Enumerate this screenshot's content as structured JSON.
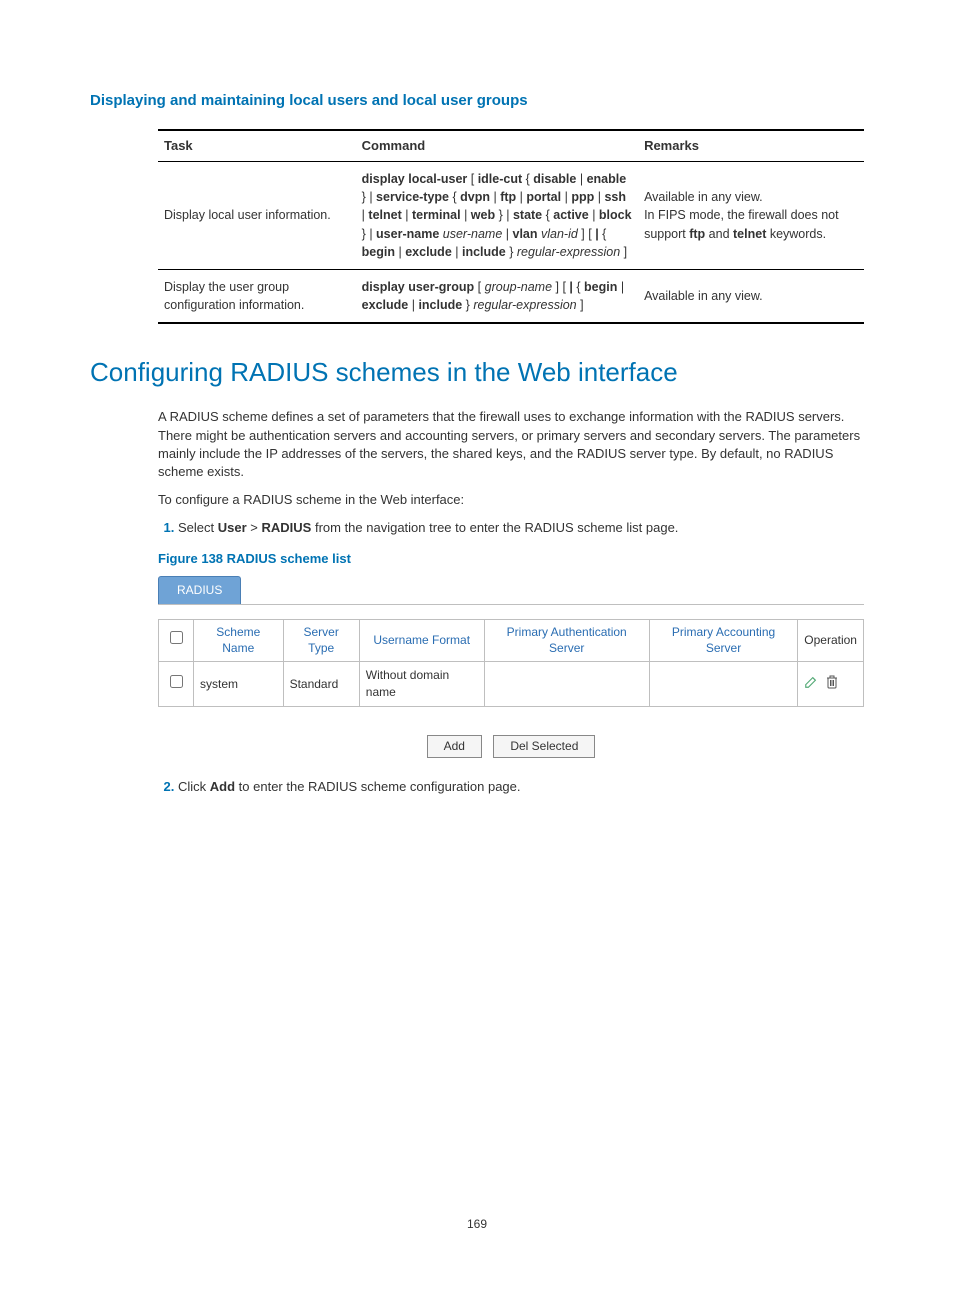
{
  "section1_title": "Displaying and maintaining local users and local user groups",
  "ref_table": {
    "headers": {
      "task": "Task",
      "command": "Command",
      "remarks": "Remarks"
    },
    "rows": [
      {
        "task": "Display local user information.",
        "command_html": "<span class='bold'>display local-user</span> [ <span class='bold'>idle-cut</span> { <span class='bold'>disable</span> | <span class='bold'>enable</span> } | <span class='bold'>service-type</span> { <span class='bold'>dvpn</span> | <span class='bold'>ftp</span> | <span class='bold'>portal</span> | <span class='bold'>ppp</span> | <span class='bold'>ssh</span> | <span class='bold'>telnet</span> | <span class='bold'>terminal</span> | <span class='bold'>web</span> } | <span class='bold'>state</span> { <span class='bold'>active</span> | <span class='bold'>block</span> } | <span class='bold'>user-name</span> <span class='ital'>user-name</span> | <span class='bold'>vlan</span> <span class='ital'>vlan-id</span> ] [ <span class='bold'>|</span> { <span class='bold'>begin</span> | <span class='bold'>exclude</span> | <span class='bold'>include</span> } <span class='ital'>regular-expression</span> ]",
        "remarks_html": "Available in any view.<br>In FIPS mode, the firewall does not support <span class='bold'>ftp</span> and <span class='bold'>telnet</span> keywords."
      },
      {
        "task": "Display the user group configuration information.",
        "command_html": "<span class='bold'>display user-group</span> [ <span class='ital'>group-name</span> ] [ <span class='bold'>|</span> { <span class='bold'>begin</span> | <span class='bold'>exclude</span> | <span class='bold'>include</span> } <span class='ital'>regular-expression</span> ]",
        "remarks_html": "Available in any view."
      }
    ]
  },
  "main_heading": "Configuring RADIUS schemes in the Web interface",
  "para1": "A RADIUS scheme defines a set of parameters that the firewall uses to exchange information with the RADIUS servers. There might be authentication servers and accounting servers, or primary servers and secondary servers. The parameters mainly include the IP addresses of the servers, the shared keys, and the RADIUS server type. By default, no RADIUS scheme exists.",
  "para2": "To configure a RADIUS scheme in the Web interface:",
  "step1_html": "Select <span class='bold'>User</span> &gt; <span class='bold'>RADIUS</span> from the navigation tree to enter the RADIUS scheme list page.",
  "figure_caption": "Figure 138 RADIUS scheme list",
  "radius_ui": {
    "tab": "RADIUS",
    "headers": {
      "scheme_name": "Scheme Name",
      "server_type": "Server Type",
      "username_format": "Username Format",
      "primary_auth": "Primary Authentication Server",
      "primary_acct": "Primary Accounting Server",
      "operation": "Operation"
    },
    "row": {
      "scheme_name": "system",
      "server_type": "Standard",
      "username_format": "Without domain name",
      "primary_auth": "",
      "primary_acct": ""
    },
    "buttons": {
      "add": "Add",
      "del": "Del Selected"
    }
  },
  "step2_html": "Click <span class='bold'>Add</span> to enter the RADIUS scheme configuration page.",
  "page_number": "169"
}
